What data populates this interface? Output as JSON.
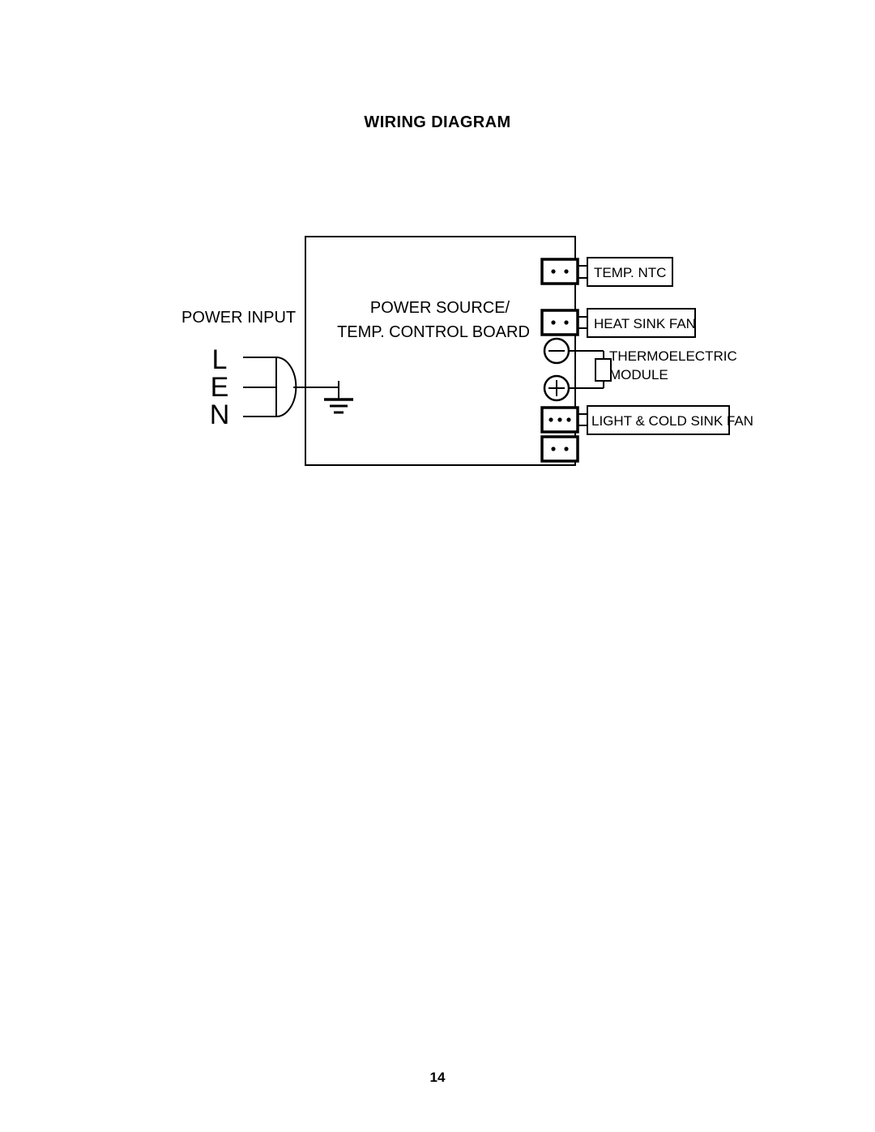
{
  "document": {
    "title": "WIRING DIAGRAM",
    "page_number": "14"
  },
  "diagram": {
    "power_input": {
      "label": "POWER INPUT",
      "terminals": [
        {
          "name": "line",
          "label": "L"
        },
        {
          "name": "earth",
          "label": "E"
        },
        {
          "name": "neutral",
          "label": "N"
        }
      ],
      "plug_symbol": "mains-plug-icon",
      "ground_symbol": "earth-ground-icon"
    },
    "control_board": {
      "title_line1": "POWER SOURCE/",
      "title_line2": "TEMP. CONTROL BOARD"
    },
    "components": [
      {
        "id": "temp-ntc",
        "label": "TEMP. NTC",
        "connector_pins": 2,
        "connector_name": "connector-2pin-temp-ntc",
        "boxed": true
      },
      {
        "id": "heat-sink-fan",
        "label": "HEAT SINK FAN",
        "connector_pins": 2,
        "connector_name": "connector-2pin-heat-sink-fan",
        "boxed": true
      },
      {
        "id": "thermoelectric-module",
        "label_line1": "THERMOELECTRIC",
        "label_line2": "MODULE",
        "terminals": [
          {
            "name": "negative-terminal",
            "symbol": "minus-circle-icon"
          },
          {
            "name": "positive-terminal",
            "symbol": "plus-circle-icon"
          }
        ],
        "boxed": false
      },
      {
        "id": "light-cold-sink-fan",
        "label": "LIGHT & COLD SINK FAN",
        "connector_pins": 3,
        "connector_name": "connector-3pin-light-cold-sink-fan",
        "boxed": true
      },
      {
        "id": "spare-connector",
        "label": "",
        "connector_pins": 2,
        "connector_name": "connector-2pin-spare",
        "boxed": false
      }
    ],
    "colors": {
      "line": "#000000",
      "background": "#ffffff"
    }
  }
}
